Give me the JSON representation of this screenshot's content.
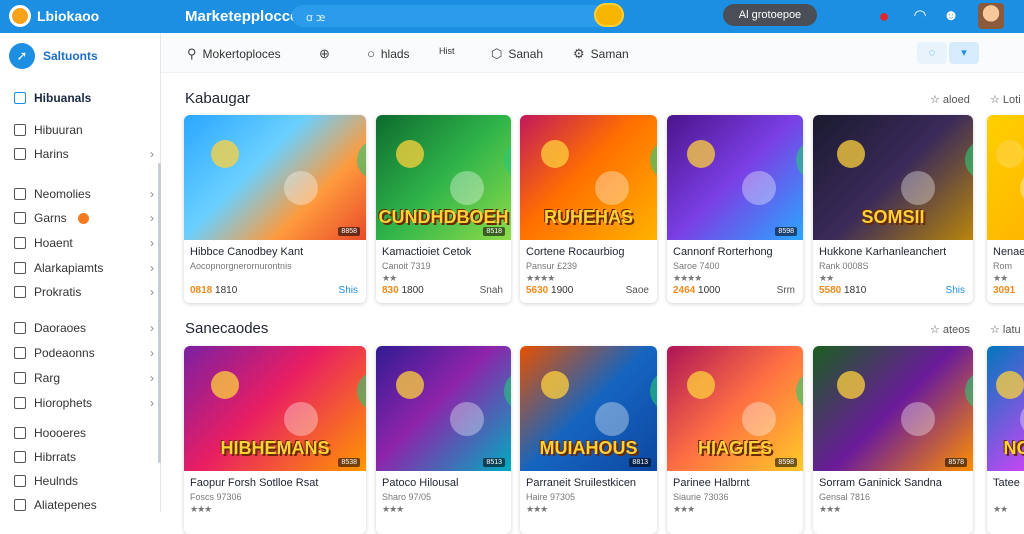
{
  "app": {
    "logo_text": "Lbiokaoo",
    "title": "Marketepplocce",
    "search_text": "ꭤ ꭢ",
    "pill": "Al grotoepoe"
  },
  "sidebar": {
    "header": "Saltuonts",
    "items": [
      {
        "label": "Hibuanals",
        "active": true
      },
      {
        "label": "Hibuuran"
      },
      {
        "label": "Harins"
      },
      {
        "label": "Neomolies"
      },
      {
        "label": "Garns"
      },
      {
        "label": "Hoaent"
      },
      {
        "label": "Alarkapiamts"
      },
      {
        "label": "Prokratis"
      },
      {
        "label": "Daoraoes"
      },
      {
        "label": "Podeaonns"
      },
      {
        "label": "Rarg"
      },
      {
        "label": "Hiorophets"
      },
      {
        "label": "Hoooeres"
      },
      {
        "label": "Hibrrats"
      },
      {
        "label": "Heulnds"
      },
      {
        "label": "Aliatepenes"
      }
    ]
  },
  "filters": {
    "f1": "Mokertoploces",
    "f3": "hlads",
    "f4": "Hist",
    "f5": "Sanah",
    "f6": "Saman"
  },
  "sections": [
    {
      "title": "Kabaugar",
      "more1": "aloed",
      "more2": "Loti"
    },
    {
      "title": "Sanecaodes",
      "more1": "ateos",
      "more2": "latu"
    }
  ],
  "row1": [
    {
      "title": "Hibbce Canodbey Kant",
      "sub": "Aocopnorgnerornurontnis",
      "price": "0818",
      "old": "1810",
      "action": "Shis",
      "action_blue": true,
      "tag": "8858",
      "overlay": ""
    },
    {
      "title": "Kamactioiet Cetok",
      "sub": "Canoit 7319",
      "stars": "★★",
      "price": "830",
      "old": "1800",
      "action": "Snah",
      "tag": "8518",
      "overlay": "CUNDHDBOEH"
    },
    {
      "title": "Cortene Rocaurbiog",
      "sub": "Pansur £239",
      "stars": "★★★★",
      "price": "5630",
      "old": "1900",
      "action": "Saoe",
      "tag": "",
      "overlay": "RUHEHAS"
    },
    {
      "title": "Cannonf Rorterhong",
      "sub": "Saroe 7400",
      "stars": "★★★★",
      "price": "2464",
      "old": "1000",
      "action": "Srm",
      "tag": "8598",
      "overlay": ""
    },
    {
      "title": "Hukkone Karhanleanchert",
      "sub": "Rank 0008S",
      "stars": "★★",
      "price": "5580",
      "old": "1810",
      "action": "Shis",
      "action_blue": true,
      "tag": "",
      "overlay": "SOMSII"
    },
    {
      "title": "Nenae",
      "sub": "Rom",
      "stars": "★★",
      "price": "3091",
      "old": "",
      "action": "",
      "tag": "",
      "overlay": ""
    }
  ],
  "row2": [
    {
      "title": "Faopur Forsh Sotlloe Rsat",
      "sub": "Foscs 97306",
      "stars": "★★★",
      "tag": "8538",
      "overlay": "HIBHEMANS"
    },
    {
      "title": "Patoco Hilousal",
      "sub": "Sharo 97/05",
      "stars": "★★★",
      "tag": "8513",
      "overlay": ""
    },
    {
      "title": "Parraneit Sruilestkicen",
      "sub": "Haire 97305",
      "stars": "★★★",
      "tag": "8813",
      "overlay": "MUIAHOUS"
    },
    {
      "title": "Parinee Halbrnt",
      "sub": "Siaurie 73036",
      "stars": "★★★",
      "tag": "8598",
      "overlay": "HIAGIES"
    },
    {
      "title": "Sorram Ganinick Sandna",
      "sub": "Gensal 7816",
      "stars": "★★★",
      "tag": "8578",
      "overlay": ""
    },
    {
      "title": "Tatee",
      "sub": "",
      "stars": "★★",
      "tag": "",
      "overlay": "NO"
    }
  ]
}
